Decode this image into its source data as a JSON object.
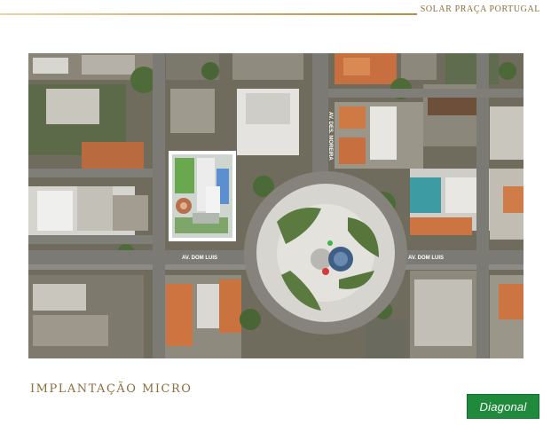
{
  "header": {
    "title": "SOLAR PRAÇA PORTUGAL"
  },
  "map": {
    "streets": {
      "av_dom_luis_left": "AV. DOM LUIS",
      "av_dom_luis_right": "AV. DOM LUIS",
      "av_des_moreira": "AV. DES. MOREIRA"
    }
  },
  "footer": {
    "section_title": "IMPLANTAÇÃO MICRO",
    "logo_text": "Diagonal"
  },
  "colors": {
    "accent_gold": "#b88f45",
    "logo_green": "#1f8a3b"
  }
}
